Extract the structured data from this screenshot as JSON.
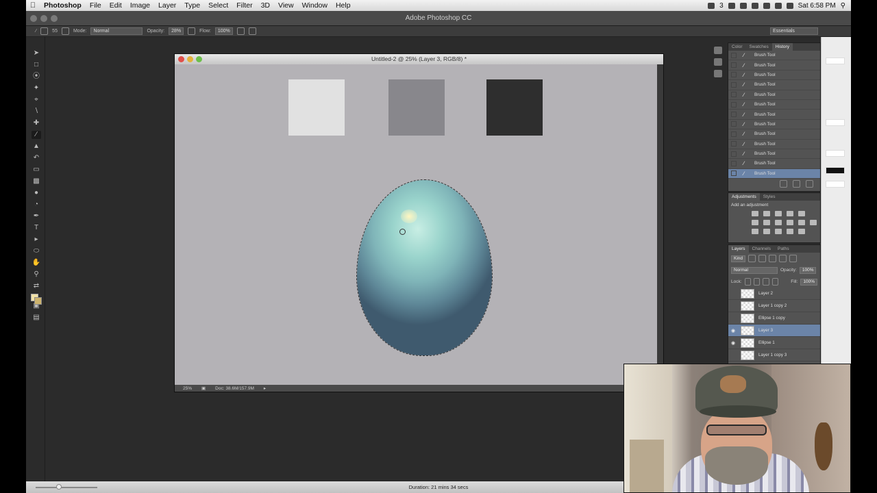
{
  "menubar": {
    "app": "Photoshop",
    "items": [
      "File",
      "Edit",
      "Image",
      "Layer",
      "Type",
      "Select",
      "Filter",
      "3D",
      "View",
      "Window",
      "Help"
    ],
    "battery_label": "3",
    "clock": "Sat 6:58 PM"
  },
  "appbar": {
    "title": "Adobe Photoshop CC"
  },
  "options": {
    "brush_size": "55",
    "mode_label": "Mode:",
    "mode_value": "Normal",
    "opacity_label": "Opacity:",
    "opacity_value": "28%",
    "flow_label": "Flow:",
    "flow_value": "100%",
    "workspace": "Essentials"
  },
  "document": {
    "title": "Untitled-2 @ 25% (Layer 3, RGB/8) *",
    "zoom": "25%",
    "doc_size": "Doc: 38.6M/157.9M",
    "swatch_colors": [
      "#e1e1e1",
      "#88878c",
      "#2e2e2e"
    ],
    "egg_colors": {
      "light": "#c8eee4",
      "mid": "#7fb4b8",
      "dark": "#3f5a6e"
    }
  },
  "history": {
    "tabs": [
      "Color",
      "Swatches",
      "History"
    ],
    "active_tab": "History",
    "items": [
      "Brush Tool",
      "Brush Tool",
      "Brush Tool",
      "Brush Tool",
      "Brush Tool",
      "Brush Tool",
      "Brush Tool",
      "Brush Tool",
      "Brush Tool",
      "Brush Tool",
      "Brush Tool",
      "Brush Tool",
      "Brush Tool"
    ],
    "selected_index": 12
  },
  "adjustments": {
    "tabs": [
      "Adjustments",
      "Styles"
    ],
    "active_tab": "Adjustments",
    "title": "Add an adjustment"
  },
  "layers": {
    "tabs": [
      "Layers",
      "Channels",
      "Paths"
    ],
    "active_tab": "Layers",
    "kind_label": "Kind",
    "blend_mode": "Normal",
    "opacity_label": "Opacity:",
    "opacity_value": "100%",
    "lock_label": "Lock:",
    "fill_label": "Fill:",
    "fill_value": "100%",
    "items": [
      {
        "name": "Layer 2",
        "visible": false
      },
      {
        "name": "Layer 1 copy 2",
        "visible": false
      },
      {
        "name": "Ellipse 1 copy",
        "visible": false
      },
      {
        "name": "Layer 3",
        "visible": true
      },
      {
        "name": "Ellipse 1",
        "visible": true
      },
      {
        "name": "Layer 1 copy 3",
        "visible": false
      }
    ],
    "selected_index": 3
  },
  "bottombar": {
    "duration": "Duration: 21 mins 34 secs"
  },
  "colors": {
    "accent_selection": "#6b84a8",
    "foreground": "#f1e1a6",
    "background": "#cdb36d"
  }
}
